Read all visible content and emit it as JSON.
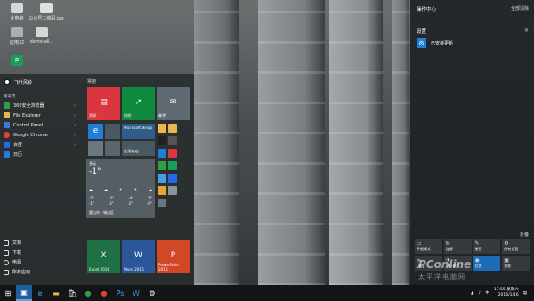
{
  "desktop_icons": [
    {
      "label": "此电脑",
      "name": "this-pc-icon",
      "color": "#cfd8dc"
    },
    {
      "label": "公众号二维码.jpg",
      "name": "qr-image-icon",
      "color": "#e0e0e0"
    },
    {
      "label": "应用32",
      "name": "app32-icon",
      "color": "#a8b0b4"
    },
    {
      "label": "demo-all...",
      "name": "demo-file-icon",
      "color": "#d6d6d6"
    },
    {
      "label": "P",
      "name": "p-app-icon",
      "color": "#18a058"
    }
  ],
  "start_menu": {
    "user": "飞叶风铃",
    "section_label": "最常用",
    "apps": [
      {
        "label": "360安全浏览器",
        "color": "#2ea043",
        "arrow": "›"
      },
      {
        "label": "File Explorer",
        "color": "#e8b84a",
        "arrow": "›"
      },
      {
        "label": "Control Panel",
        "color": "#3a7bd5",
        "arrow": "›"
      },
      {
        "label": "Google Chrome",
        "color": "#db4437",
        "arrow": "›"
      },
      {
        "label": "百度",
        "color": "#2468f2",
        "arrow": "›"
      },
      {
        "label": "日历",
        "color": "#1e7fd6",
        "arrow": ""
      }
    ],
    "bottom": [
      {
        "label": "文档"
      },
      {
        "label": "下载"
      },
      {
        "label": "电源"
      },
      {
        "label": "所有应用"
      }
    ],
    "tiles_title": "常用",
    "tiles": [
      {
        "label": "资讯",
        "color": "#d9363e",
        "glyph": "▤"
      },
      {
        "label": "财经",
        "color": "#0f8a3c",
        "glyph": "↗"
      },
      {
        "label": "邮件",
        "color": "#5f6a72",
        "glyph": "✉"
      },
      {
        "label": "Microsoft Bingo",
        "color": "#2f5d8a",
        "glyph": ""
      },
      {
        "label": "应用商店",
        "color": "#4a5862",
        "glyph": "🛍"
      },
      {
        "label": "Excel 2016",
        "color": "#1e7145",
        "glyph": "X"
      },
      {
        "label": "Word 2016",
        "color": "#2b579a",
        "glyph": "W"
      },
      {
        "label": "PowerPoint 2016",
        "color": "#d24726",
        "glyph": "P"
      }
    ],
    "weather": {
      "location": "多云",
      "temp": "-1°",
      "days": [
        "-5°",
        "-2°",
        "-4°",
        "1°",
        "-1°",
        "-3°",
        "-2°",
        "-6°"
      ],
      "footer": "惠山市 - 锡山区"
    }
  },
  "action_center": {
    "title": "操作中心",
    "clear_all": "全部清除",
    "section": "设置",
    "notification": "已安装更新",
    "collapse": "折叠",
    "quick_actions": [
      {
        "label": "平板模式",
        "icon": "▭",
        "on": false
      },
      {
        "label": "连接",
        "icon": "⇆",
        "on": false
      },
      {
        "label": "便签",
        "icon": "✎",
        "on": false
      },
      {
        "label": "所有设置",
        "icon": "⚙",
        "on": false
      },
      {
        "label": "VPN",
        "icon": "∞",
        "on": false
      },
      {
        "label": "飞行模式",
        "icon": "✈",
        "on": false
      },
      {
        "label": "位置",
        "icon": "◉",
        "on": true
      },
      {
        "label": "投影",
        "icon": "▣",
        "on": false
      }
    ]
  },
  "taskbar": {
    "time": "17:55 星期六",
    "date": "2016/1/16",
    "ime": "中"
  },
  "watermark": {
    "text": "PConline",
    "sub": "太平洋电脑网"
  }
}
